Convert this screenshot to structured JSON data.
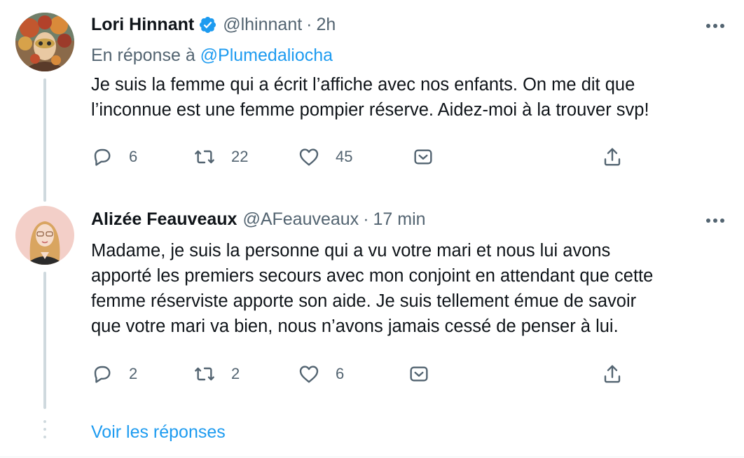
{
  "tweets": [
    {
      "name": "Lori Hinnant",
      "verified": true,
      "handle": "@lhinnant",
      "separator": "·",
      "time": "2h",
      "reply_prefix": "En réponse à ",
      "reply_handle": "@Plumedaliocha",
      "text_lines": [
        "Je suis la femme qui a écrit l’affiche avec nos enfants. On me dit que",
        "l’inconnue est une femme pompier réserve. Aidez-moi à la trouver svp!"
      ],
      "replies": "6",
      "retweets": "22",
      "likes": "45"
    },
    {
      "name": "Alizée Feauveaux",
      "verified": false,
      "handle": "@AFeauveaux",
      "separator": "·",
      "time": "17 min",
      "text_lines": [
        "Madame, je suis la personne qui a vu votre mari et nous lui avons",
        "apporté les premiers secours avec mon conjoint en attendant que cette",
        "femme réserviste apporte son aide. Je suis tellement émue de savoir",
        "que votre mari va bien, nous n’avons jamais cessé de penser à lui."
      ],
      "replies": "2",
      "retweets": "2",
      "likes": "6"
    }
  ],
  "show_replies_label": "Voir les réponses",
  "colors": {
    "text": "#0f1419",
    "secondary": "#536471",
    "accent": "#1d9bf0",
    "thread_line": "#cfd9de"
  },
  "icons": [
    "verified-badge-icon",
    "more-icon",
    "reply-icon",
    "retweet-icon",
    "like-icon",
    "bookmark-icon",
    "share-icon"
  ]
}
